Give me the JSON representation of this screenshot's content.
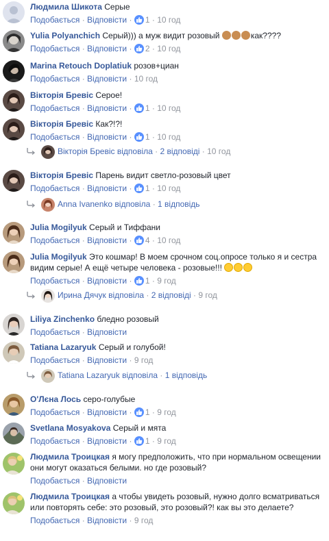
{
  "labels": {
    "like": "Подобається",
    "reply": "Відповісти",
    "dot": "·"
  },
  "comments": [
    {
      "author": "Людмила Шикота",
      "text": "Серые",
      "likes": "1",
      "time": "10 год"
    },
    {
      "author": "Yulia Polyanchich",
      "text": "Серый))) а муж видит розовый",
      "text_after": "как????",
      "likes": "2",
      "time": "10 год"
    },
    {
      "author": "Marina Retouch Doplatiuk",
      "text": "розов+циан",
      "time": "10 год"
    },
    {
      "author": "Вікторія Бревіс",
      "text": "Серое!",
      "likes": "1",
      "time": "10 год"
    },
    {
      "author": "Вікторія Бревіс",
      "text": "Как?!?!",
      "likes": "1",
      "time": "10 год",
      "reply": {
        "name": "Вікторія Бревіс",
        "verb": "відповіла",
        "count": "2 відповіді",
        "time": "10 год"
      }
    },
    {
      "author": "Вікторія Бревіс",
      "text": "Парень видит светло-розовый цвет",
      "likes": "1",
      "time": "10 год",
      "reply": {
        "name": "Anna Ivanenko",
        "verb": "відповіла",
        "count": "1 відповідь"
      }
    },
    {
      "author": "Julia Mogilyuk",
      "text": "Серый и Тиффани",
      "likes": "4",
      "time": "10 год"
    },
    {
      "author": "Julia Mogilyuk",
      "text": "Это кошмар! В моем срочном соц.опросе только я и сестра видим серые! А ещё четыре человека - розовые!!!",
      "likes": "1",
      "time": "9 год",
      "reply": {
        "name": "Ирина Дячук",
        "verb": "відповіла",
        "count": "2 відповіді",
        "time": "9 год"
      }
    },
    {
      "author": "Liliya Zinchenko",
      "text": "бледно розовый"
    },
    {
      "author": "Tatiana Lazaryuk",
      "text": "Серый и голубой!",
      "time": "9 год",
      "reply": {
        "name": "Tatiana Lazaryuk",
        "verb": "відповіла",
        "count": "1 відповідь"
      }
    },
    {
      "author": "О'Лєна Лось",
      "text": "серо-голубые",
      "likes": "1",
      "time": "9 год"
    },
    {
      "author": "Svetlana Mosyakova",
      "text": "Серый и мята",
      "likes": "1",
      "time": "9 год"
    },
    {
      "author": "Людмила Троицкая",
      "text": "я могу предположить, что при нормальном освещении они могут оказаться белыми. но где розовый?"
    },
    {
      "author": "Людмила Троицкая",
      "text": "а чтобы увидеть розовый, нужно долго всматриваться или повторять себе: это розовый, это розовый?! как вы это делаете?",
      "time": "9 год"
    }
  ],
  "colors": {
    "author": "#365899",
    "link": "#4267b2",
    "meta": "#90949c",
    "like_badge": "#5890ff"
  }
}
